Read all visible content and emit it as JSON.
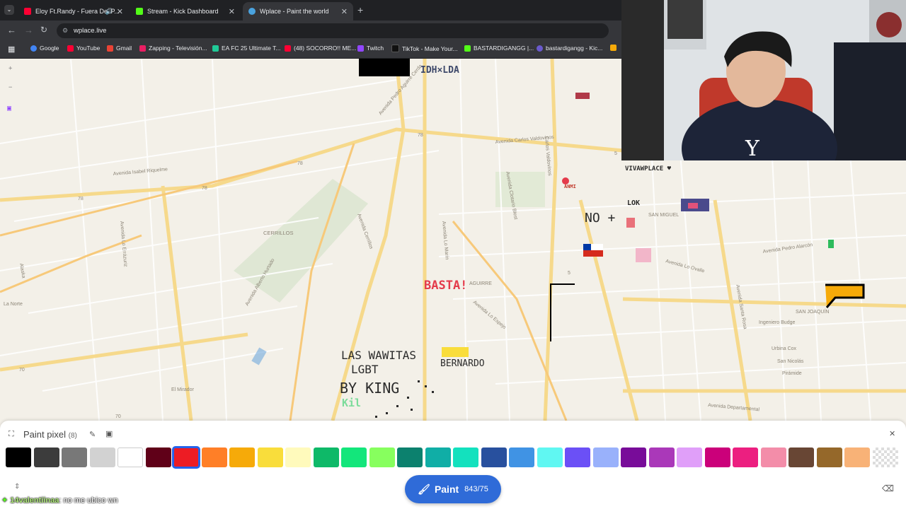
{
  "tabs": [
    {
      "title": "Eloy Ft.Randy - Fuera Del P...",
      "active": false,
      "icon": "youtube-icon",
      "color": "#ff0033"
    },
    {
      "title": "Stream - Kick Dashboard",
      "active": false,
      "icon": "kick-icon",
      "color": "#53fc18"
    },
    {
      "title": "Wplace - Paint the world",
      "active": true,
      "icon": "globe-icon",
      "color": "#4aa3df"
    }
  ],
  "address": {
    "url": "wplace.live"
  },
  "bookmarks": [
    {
      "label": "Google",
      "color": "#4285f4"
    },
    {
      "label": "YouTube",
      "color": "#ff0033"
    },
    {
      "label": "Gmail",
      "color": "#ea4335"
    },
    {
      "label": "Zapping - Televisión...",
      "color": "#e91e63"
    },
    {
      "label": "EA FC 25 Ultimate T...",
      "color": "#20c997"
    },
    {
      "label": "(48) SOCORRO!! ME...",
      "color": "#ff0033"
    },
    {
      "label": "Twitch",
      "color": "#9146ff"
    },
    {
      "label": "TikTok - Make Your...",
      "color": "#111111"
    },
    {
      "label": "BASTARDIGANGG |...",
      "color": "#53fc18"
    },
    {
      "label": "bastardigangg - Kic...",
      "color": "#6a5acd"
    }
  ],
  "map": {
    "road_labels": [
      "Avenida Pedro Aguirre Cerda",
      "78",
      "78",
      "78",
      "78",
      "70",
      "70",
      "5",
      "5",
      "CERRILLOS",
      "SAN MIGUEL",
      "SAN JOAQUÍN",
      "El Mirador",
      "La Norte",
      "Alaska",
      "Avenida Departamental",
      "Avenida Pedro Alarcón",
      "Avenida Lo Ovalle",
      "Ingeniero Budge",
      "Avenida Santa Rosa",
      "Urbina Cox",
      "San Nicolás",
      "Pirámide",
      "Avenida Lo Espejo",
      "Avenida Carlos Valdovinos",
      "Avenida Isabel Riquelme",
      "Avenida Lo Errázuriz",
      "Avenida Alberto Hurtado",
      "Avenida Cerrillos",
      "Avenida Clotario Blest",
      "Avenida Lo Marín",
      "Carlos Valdovinos",
      "AGUIRRE"
    ],
    "pixel_art": [
      {
        "text": "IDH×LDA",
        "color": "#3f4a6b"
      },
      {
        "text": "BASTA!",
        "color": "#e43b4b"
      },
      {
        "text": "LAS WAWITAS",
        "color": "#2b2b2b"
      },
      {
        "text": "LGBT",
        "color": "#2b2b2b"
      },
      {
        "text": "BY KING",
        "color": "#2b2b2b"
      },
      {
        "text": "BERNARDO",
        "color": "#2b2b2b"
      },
      {
        "text": "VIVAWPLACE ♥",
        "color": "#2b2b2b"
      },
      {
        "text": "LOK",
        "color": "#2b2b2b"
      },
      {
        "text": "NO +",
        "color": "#2b2b2b"
      },
      {
        "text": "ANMI",
        "color": "#c0392b"
      },
      {
        "text": "Kil",
        "color": "#7bdc9a"
      }
    ]
  },
  "panel": {
    "title": "Paint pixel",
    "count": "(8)",
    "paint_label": "Paint",
    "charges": "843/75",
    "colors": [
      "#000000",
      "#3c3c3c",
      "#787878",
      "#d2d2d2",
      "#ffffff",
      "#600018",
      "#ed1c24",
      "#ff7f27",
      "#f6aa09",
      "#f9dd3b",
      "#fffabc",
      "#0eb968",
      "#13e67b",
      "#87ff5e",
      "#0c816e",
      "#10aea6",
      "#13e1be",
      "#28509e",
      "#4093e4",
      "#60f7f2",
      "#6b50f6",
      "#99b1fb",
      "#780c99",
      "#aa38b9",
      "#e09ff9",
      "#cb007a",
      "#ec1f80",
      "#f38da9",
      "#684634",
      "#95682a",
      "#f8b277",
      "transparent"
    ],
    "selected_index": 6
  },
  "chat": {
    "user": "14valentiinaa",
    "message": ": no me ubico wn"
  }
}
